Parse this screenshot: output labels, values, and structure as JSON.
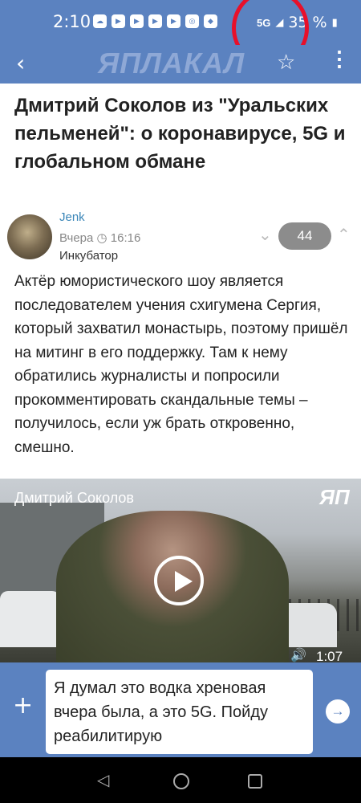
{
  "status_bar": {
    "time": "2:10",
    "network": "5G",
    "battery": "35 %"
  },
  "app_bar": {
    "logo": "ЯПЛАКАЛ"
  },
  "article": {
    "title": "Дмитрий Соколов из \"Уральских пельменей\": о коронавирусе, 5G и глобальном обмане",
    "author": "Jenk",
    "date_label": "Вчера",
    "time": "16:16",
    "rank": "Инкубатор",
    "votes": "44",
    "body": "Актёр юмористического шоу является последователем учения схигумена Сергия, который захватил монастырь, поэтому пришёл на митинг в его поддержку. Там к нему обратились журналисты и попросили прокомментировать скандальные темы – получилось, если уж брать откровенно, смешно."
  },
  "video": {
    "title": "Дмитрий Соколов",
    "logo": "ЯП",
    "duration": "1:07"
  },
  "comment": {
    "text": "Я думал это водка хреновая вчера была, а это 5G. Пойду реабилитирую"
  },
  "colors": {
    "accent": "#5b82c0",
    "highlight_circle": "#e8102a"
  }
}
